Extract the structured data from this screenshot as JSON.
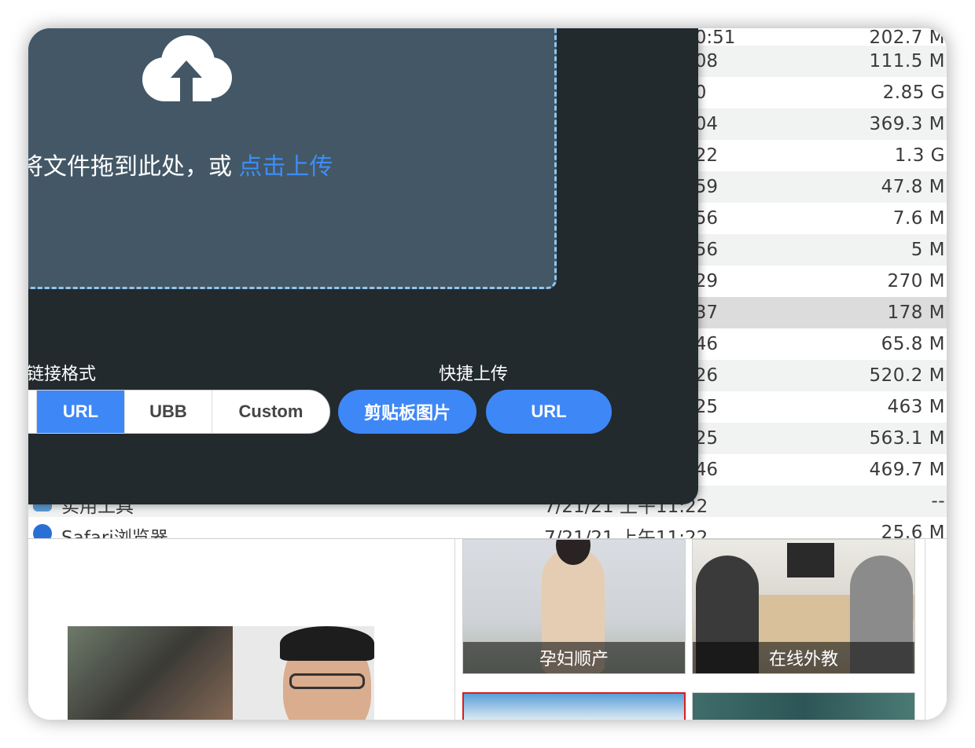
{
  "finder": {
    "rows": [
      {
        "date": ":0:51",
        "size": "202.7 M"
      },
      {
        "date": ":08",
        "size": "111.5 M"
      },
      {
        "date": ":0",
        "size": "2.85 G"
      },
      {
        "date": ":04",
        "size": "369.3 M"
      },
      {
        "date": ":22",
        "size": "1.3 G"
      },
      {
        "date": ":59",
        "size": "47.8 M"
      },
      {
        "date": ":56",
        "size": "7.6 M"
      },
      {
        "date": ":56",
        "size": "5 M"
      },
      {
        "date": ":29",
        "size": "270 M"
      },
      {
        "date": ":37",
        "size": "178 M"
      },
      {
        "date": ":46",
        "size": "65.8 M"
      },
      {
        "date": ":26",
        "size": "520.2 M"
      },
      {
        "date": ":25",
        "size": "463 M"
      },
      {
        "date": ":25",
        "size": "563.1 M"
      },
      {
        "date": ":46",
        "size": "469.7 M"
      }
    ],
    "apps": [
      {
        "name": "实用工具",
        "date": "7/21/21 上午11:22",
        "size": "--"
      },
      {
        "name": "Safari浏览器",
        "date": "7/21/21 上午11:22",
        "size": "25.6 M"
      }
    ]
  },
  "upload": {
    "drop_text": "将文件拖到此处，或 ",
    "drop_link": "点击上传",
    "format_label": "链接格式",
    "format_options": [
      "URL",
      "UBB",
      "Custom"
    ],
    "active_format": "URL",
    "quick_label": "快捷上传",
    "quick_buttons": [
      "剪贴板图片",
      "URL"
    ]
  },
  "web": {
    "tiles": [
      "孕妇顺产",
      "在线外教"
    ]
  },
  "colors": {
    "accent": "#3e87f6",
    "panel_bg": "#222a2e",
    "dropzone_bg": "#435766",
    "dropzone_border": "#8fc6f0"
  }
}
